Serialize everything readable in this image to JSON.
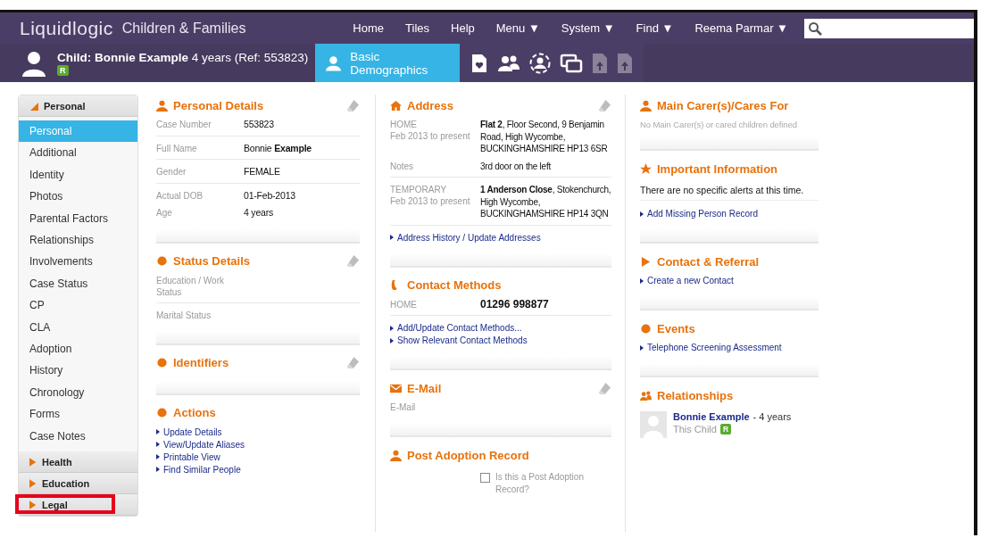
{
  "header": {
    "logo": "Liquidlogic",
    "product": "Children & Families",
    "nav": [
      "Home",
      "Tiles",
      "Help",
      "Menu ▼",
      "System ▼",
      "Find ▼",
      "Reema Parmar ▼"
    ]
  },
  "subject": {
    "title": "**Child: Bonnie Example** 4 years (Ref: 553823)",
    "badge": "R"
  },
  "tabs": [
    {
      "label": "Basic Demographics",
      "selected": true
    }
  ],
  "toolbar_icons": [
    {
      "disabled": false
    },
    {
      "disabled": false
    },
    {
      "disabled": false
    },
    {
      "disabled": false
    },
    {
      "disabled": true
    },
    {
      "disabled": true
    }
  ],
  "sidebar": {
    "groups": [
      {
        "label": "Personal",
        "expanded": true,
        "highlighted": false,
        "items": [
          {
            "label": "Personal",
            "selected": true
          },
          {
            "label": "Additional",
            "selected": false
          },
          {
            "label": "Identity",
            "selected": false
          },
          {
            "label": "Photos",
            "selected": false
          },
          {
            "label": "Parental Factors",
            "selected": false
          },
          {
            "label": "Relationships",
            "selected": false
          },
          {
            "label": "Involvements",
            "selected": false
          },
          {
            "label": "Case Status",
            "selected": false
          },
          {
            "label": "CP",
            "selected": false
          },
          {
            "label": "CLA",
            "selected": false
          },
          {
            "label": "Adoption",
            "selected": false
          },
          {
            "label": "History",
            "selected": false
          },
          {
            "label": "Chronology",
            "selected": false
          },
          {
            "label": "Forms",
            "selected": false
          },
          {
            "label": "Case Notes",
            "selected": false
          }
        ]
      },
      {
        "label": "Health",
        "expanded": false,
        "highlighted": false
      },
      {
        "label": "Education",
        "expanded": false,
        "highlighted": false
      },
      {
        "label": "Legal",
        "expanded": false,
        "highlighted": true
      }
    ]
  },
  "columns": [
    {
      "sections": [
        {
          "title": "Personal Details",
          "editable": true,
          "rows": [
            {
              "label": "Case Number",
              "value": "553823",
              "divided": true
            },
            {
              "label": "Full Name",
              "value": "Bonnie **Example**",
              "divided": true
            },
            {
              "label": "Gender",
              "value": "FEMALE",
              "divided": true
            },
            {
              "label": "Actual DOB",
              "value": "01-Feb-2013",
              "divided": false
            },
            {
              "label": "Age",
              "value": "4 years",
              "divided": false
            }
          ]
        },
        {
          "title": "Status Details",
          "editable": true,
          "rows": [
            {
              "label": "Education / Work Status",
              "divided": true
            },
            {
              "label": "Marital Status",
              "divided": false
            }
          ]
        },
        {
          "title": "Identifiers",
          "editable": true
        },
        {
          "title": "Actions",
          "editable": false,
          "links": [
            "Update Details",
            "View/Update Aliases",
            "Printable View",
            "Find Similar People"
          ]
        }
      ]
    },
    {
      "sections": [
        {
          "title": "Address",
          "editable": true,
          "rows": [
            {
              "label": "HOME",
              "sublabel": "Feb 2013 to present",
              "value": "**Flat 2**, Floor Second, 9 Benjamin Road, High Wycombe, BUCKINGHAMSHIRE HP13 6SR",
              "divided": false
            },
            {
              "label": "Notes",
              "value": "3rd door on the left",
              "divided": true
            },
            {
              "label": "TEMPORARY",
              "sublabel": "Feb 2013 to present",
              "value": "**1 Anderson Close**, Stokenchurch, High Wycombe, BUCKINGHAMSHIRE HP14 3QN",
              "divided": true
            }
          ],
          "links": [
            "Address History / Update Addresses"
          ]
        },
        {
          "title": "Contact Methods",
          "editable": false,
          "rows": [
            {
              "label": "HOME",
              "value": "01296 998877",
              "strong": true,
              "divided": true
            }
          ],
          "links": [
            "Add/Update Contact Methods...",
            "Show Relevant Contact Methods"
          ]
        },
        {
          "title": "E-Mail",
          "editable": true,
          "rows": [
            {
              "label": "E-Mail",
              "divided": false
            }
          ]
        },
        {
          "title": "Post Adoption Record",
          "editable": false,
          "checkbox": {
            "label": "Is this a Post Adoption Record?",
            "checked": false
          }
        }
      ]
    },
    {
      "sections": [
        {
          "title": "Main Carer(s)/Cares For",
          "editable": false,
          "note": "No Main Carer(s) or cared children defined"
        },
        {
          "title": "Important Information",
          "editable": false,
          "text": "There are no specific alerts at this time.",
          "links": [
            "Add Missing Person Record"
          ]
        },
        {
          "title": "Contact & Referral",
          "editable": false,
          "links": [
            "Create a new Contact"
          ]
        },
        {
          "title": "Events",
          "editable": false,
          "links": [
            "Telephone Screening Assessment"
          ]
        },
        {
          "title": "Relationships",
          "editable": false,
          "people": [
            {
              "name": "Bonnie Example",
              "age": "- 4 years",
              "role": "This Child",
              "badge": "R"
            }
          ]
        }
      ]
    }
  ]
}
